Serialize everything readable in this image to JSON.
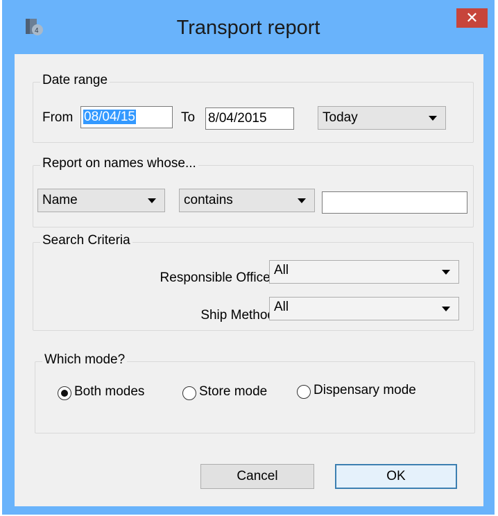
{
  "window": {
    "title": "Transport report",
    "icon": "app-icon",
    "close_glyph": "✕"
  },
  "date_range": {
    "legend": "Date range",
    "from_label": "From",
    "from_value": "08/04/15",
    "to_label": "To",
    "to_value": "8/04/2015",
    "preset": "Today"
  },
  "names": {
    "legend": "Report on names whose...",
    "field": "Name",
    "operator": "contains",
    "value": ""
  },
  "criteria": {
    "legend": "Search Criteria",
    "officer_label": "Responsible Officer",
    "officer_value": "All",
    "ship_label": "Ship Method",
    "ship_value": "All"
  },
  "mode": {
    "legend": "Which mode?",
    "options": [
      {
        "label": "Both modes",
        "selected": true
      },
      {
        "label": "Store mode",
        "selected": false
      },
      {
        "label": "Dispensary mode",
        "selected": false
      }
    ]
  },
  "buttons": {
    "cancel": "Cancel",
    "ok": "OK"
  },
  "colors": {
    "title_bar": "#69b3fb",
    "close": "#c7453b",
    "selection": "#3399ff"
  }
}
